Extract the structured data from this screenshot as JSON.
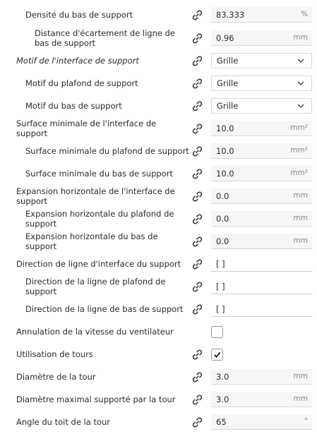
{
  "settings": [
    {
      "label": "Densité du bas de support",
      "level": 1,
      "control": "field",
      "value": "83.333",
      "unit": "%",
      "link": true
    },
    {
      "label": "Distance d'écartement de ligne de bas de support",
      "level": 2,
      "control": "field",
      "value": "0.96",
      "unit": "mm",
      "link": true
    },
    {
      "label": "Motif de l'interface de support",
      "level": 0,
      "italic": true,
      "control": "combo",
      "value": "Grille",
      "link": true
    },
    {
      "label": "Motif du plafond de support",
      "level": 1,
      "control": "combo",
      "value": "Grille",
      "link": true
    },
    {
      "label": "Motif du bas de support",
      "level": 1,
      "control": "combo",
      "value": "Grille",
      "link": true
    },
    {
      "label": "Surface minimale de l'interface de support",
      "level": 0,
      "control": "field",
      "value": "10.0",
      "unit": "mm²",
      "link": true
    },
    {
      "label": "Surface minimale du plafond de support",
      "level": 1,
      "control": "field",
      "value": "10.0",
      "unit": "mm²",
      "link": true
    },
    {
      "label": "Surface minimale du bas de support",
      "level": 1,
      "control": "field",
      "value": "10.0",
      "unit": "mm²",
      "link": true
    },
    {
      "label": "Expansion horizontale de l'interface de support",
      "level": 0,
      "control": "field",
      "value": "0.0",
      "unit": "mm",
      "link": true
    },
    {
      "label": "Expansion horizontale du plafond de support",
      "level": 1,
      "control": "field",
      "value": "0.0",
      "unit": "mm",
      "link": true
    },
    {
      "label": "Expansion horizontale du bas de support",
      "level": 1,
      "control": "field",
      "value": "0.0",
      "unit": "mm",
      "link": true
    },
    {
      "label": "Direction de ligne d'interface du support",
      "level": 0,
      "control": "text",
      "value": "[ ]",
      "link": true
    },
    {
      "label": "Direction de la ligne de plafond de support",
      "level": 1,
      "control": "text",
      "value": "[ ]",
      "link": true
    },
    {
      "label": "Direction de la ligne de bas de support",
      "level": 1,
      "control": "text",
      "value": "[ ]",
      "link": true
    },
    {
      "label": "Annulation de la vitesse du ventilateur",
      "level": 0,
      "control": "checkbox",
      "checked": false,
      "link": false
    },
    {
      "label": "Utilisation de tours",
      "level": 0,
      "control": "checkbox",
      "checked": true,
      "link": true
    },
    {
      "label": "Diamètre de la tour",
      "level": 0,
      "control": "field",
      "value": "3.0",
      "unit": "mm",
      "link": true
    },
    {
      "label": "Diamètre maximal supporté par la tour",
      "level": 0,
      "control": "field",
      "value": "3.0",
      "unit": "mm",
      "link": true
    },
    {
      "label": "Angle du toit de la tour",
      "level": 0,
      "control": "field",
      "value": "65",
      "unit": "°",
      "link": true
    }
  ],
  "icons": {
    "link": "link-icon",
    "dropdown": "chevron-down-icon",
    "check": "checkmark-icon"
  },
  "colors": {
    "field_bg": "#f6f6f6",
    "field_border": "#d8d8d8",
    "text": "#2b2b2b",
    "unit": "#888888"
  }
}
